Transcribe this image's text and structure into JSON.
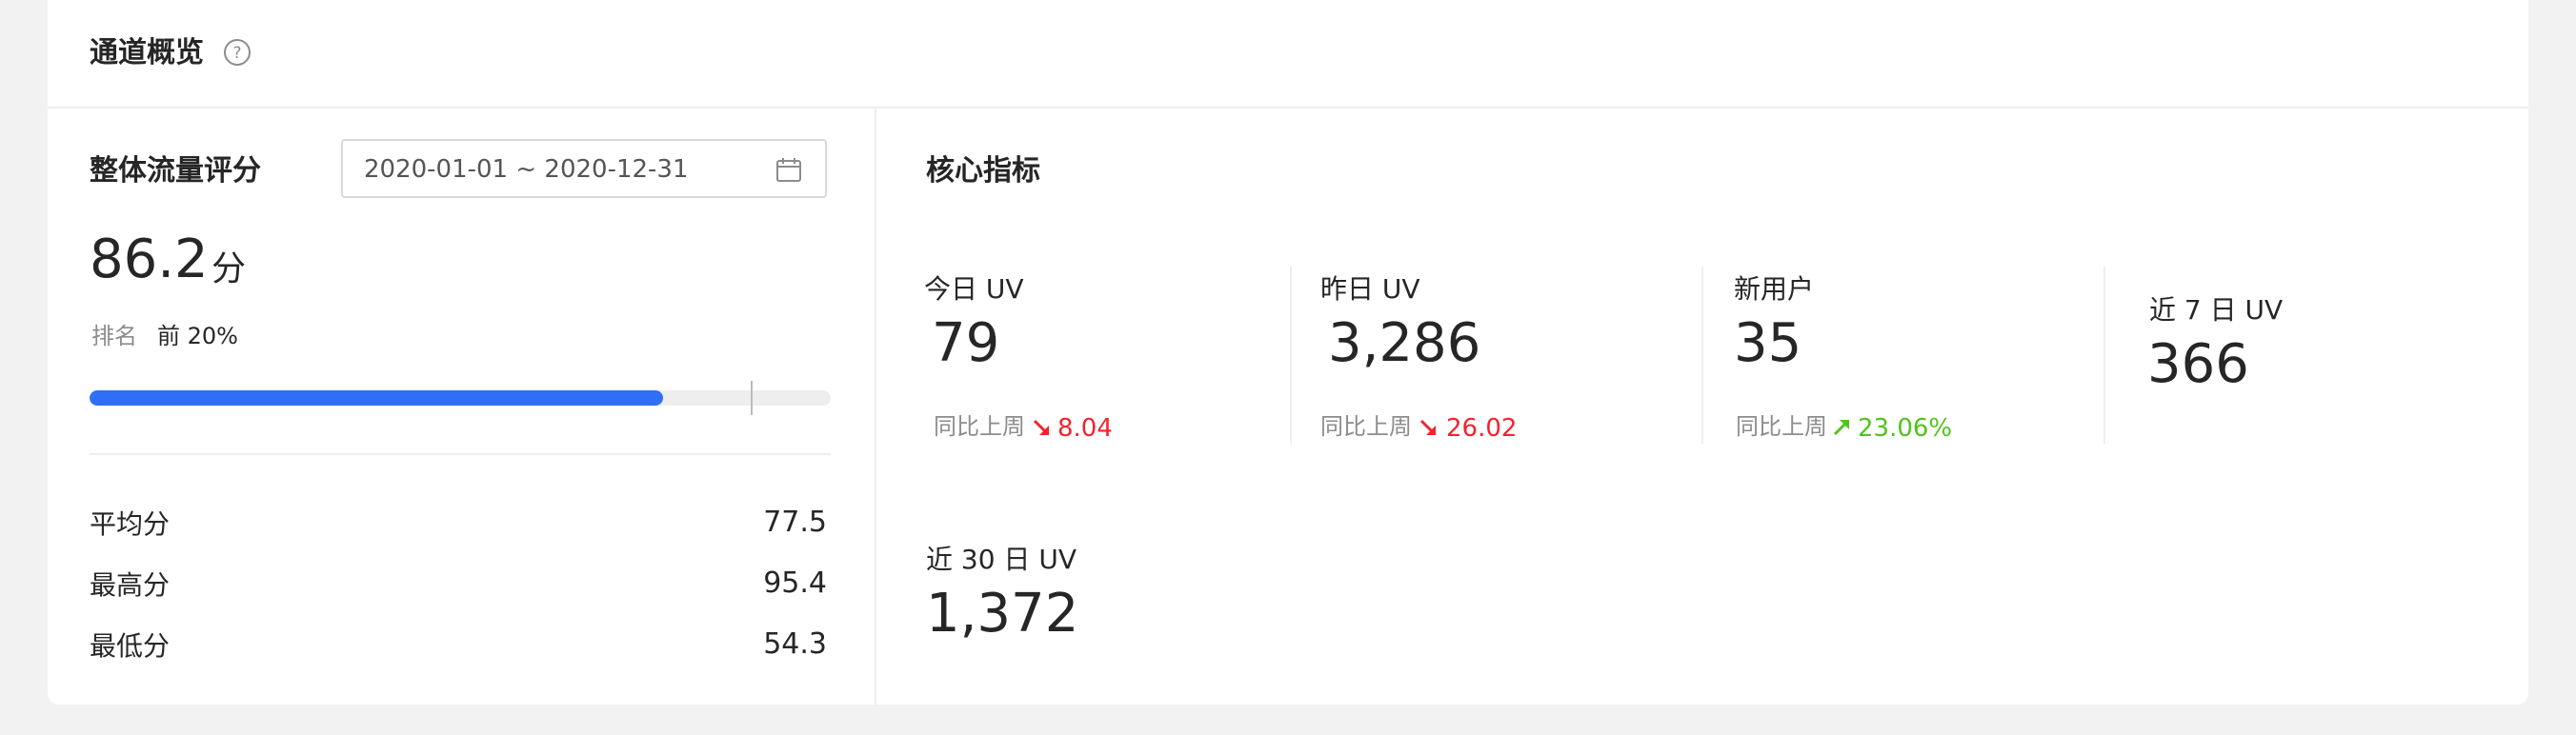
{
  "header": {
    "title": "通道概览",
    "help_icon": "question-circle-icon"
  },
  "score_panel": {
    "title": "整体流量评分",
    "date_range": "2020-01-01 ~ 2020-12-31",
    "calendar_icon": "calendar-icon",
    "score": "86.2",
    "score_unit": "分",
    "rank_label": "排名",
    "rank_value": "前 20%",
    "progress_fraction": 0.774,
    "progress_color": "#2f6ff5",
    "stats": [
      {
        "label": "平均分",
        "value": "77.5"
      },
      {
        "label": "最高分",
        "value": "95.4"
      },
      {
        "label": "最低分",
        "value": "54.3"
      }
    ]
  },
  "metrics_panel": {
    "title": "核心指标",
    "metrics": [
      {
        "label": "今日 UV",
        "value": "79",
        "compare_label": "同比上周",
        "trend": "down",
        "change": "8.04"
      },
      {
        "label": "昨日 UV",
        "value": "3,286",
        "compare_label": "同比上周",
        "trend": "down",
        "change": "26.02"
      },
      {
        "label": "新用户",
        "value": "35",
        "compare_label": "同比上周",
        "trend": "up",
        "change": "23.06%"
      },
      {
        "label": "近 7 日 UV",
        "value": "366"
      },
      {
        "label": "近 30 日 UV",
        "value": "1,372"
      }
    ],
    "colors": {
      "down": "#f5222d",
      "up": "#52c41a"
    }
  }
}
